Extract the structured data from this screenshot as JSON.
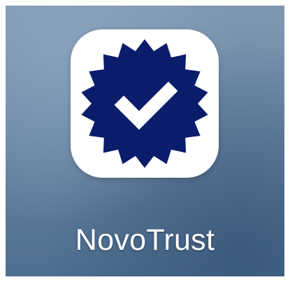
{
  "app": {
    "label": "NovoTrust",
    "icon": "verified-badge-icon",
    "badge_color": "#0b1c6b",
    "check_color": "#ffffff",
    "tile_color": "#ffffff"
  }
}
